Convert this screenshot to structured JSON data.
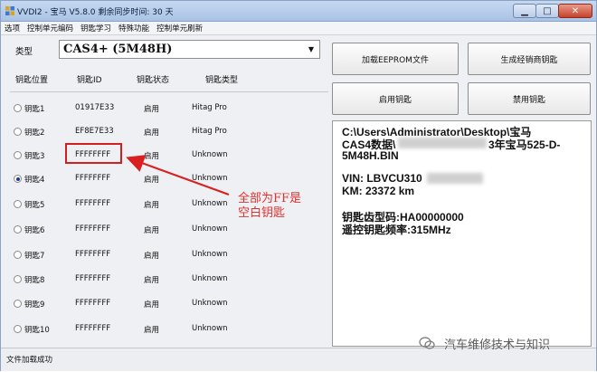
{
  "window": {
    "title": "VVDI2 - 宝马 V5.8.0    剩余同步时间: 30 天"
  },
  "menu": [
    "选项",
    "控制单元编码",
    "钥匙学习",
    "特殊功能",
    "控制单元刷新"
  ],
  "type_label": "类型",
  "type_value": "CAS4+ (5M48H)",
  "columns": [
    "钥匙位置",
    "钥匙ID",
    "钥匙状态",
    "钥匙类型"
  ],
  "keys": [
    {
      "name": "钥匙1",
      "id": "01917E33",
      "state": "启用",
      "type": "Hitag Pro",
      "selected": false
    },
    {
      "name": "钥匙2",
      "id": "EF8E7E33",
      "state": "启用",
      "type": "Hitag Pro",
      "selected": false
    },
    {
      "name": "钥匙3",
      "id": "FFFFFFFF",
      "state": "启用",
      "type": "Unknown",
      "selected": false
    },
    {
      "name": "钥匙4",
      "id": "FFFFFFFF",
      "state": "启用",
      "type": "Unknown",
      "selected": true
    },
    {
      "name": "钥匙5",
      "id": "FFFFFFFF",
      "state": "启用",
      "type": "Unknown",
      "selected": false
    },
    {
      "name": "钥匙6",
      "id": "FFFFFFFF",
      "state": "启用",
      "type": "Unknown",
      "selected": false
    },
    {
      "name": "钥匙7",
      "id": "FFFFFFFF",
      "state": "启用",
      "type": "Unknown",
      "selected": false
    },
    {
      "name": "钥匙8",
      "id": "FFFFFFFF",
      "state": "启用",
      "type": "Unknown",
      "selected": false
    },
    {
      "name": "钥匙9",
      "id": "FFFFFFFF",
      "state": "启用",
      "type": "Unknown",
      "selected": false
    },
    {
      "name": "钥匙10",
      "id": "FFFFFFFF",
      "state": "启用",
      "type": "Unknown",
      "selected": false
    }
  ],
  "buttons": {
    "load_eeprom": "加载EEPROM文件",
    "gen_dealer_key": "生成经销商钥匙",
    "enable_key": "启用钥匙",
    "disable_key": "禁用钥匙"
  },
  "info": {
    "path_line1": "C:\\Users\\Administrator\\Desktop\\宝马",
    "path_line2_a": "CAS4数据\\",
    "path_line2_b": "3年宝马525-D-",
    "path_line3": "5M48H.BIN",
    "vin": "VIN: LBVCU310",
    "km": "KM:  23372 km",
    "key_code": "钥匙齿型码:HA00000000",
    "remote_freq": "遥控钥匙频率:315MHz"
  },
  "annotation": [
    "全部为FF是",
    "空白钥匙"
  ],
  "status": "文件加载成功",
  "watermark": "汽车维修技术与知识",
  "colors": {
    "annotation": "#e03030",
    "title_bar": "#b8cfec",
    "close": "#c7422c"
  }
}
